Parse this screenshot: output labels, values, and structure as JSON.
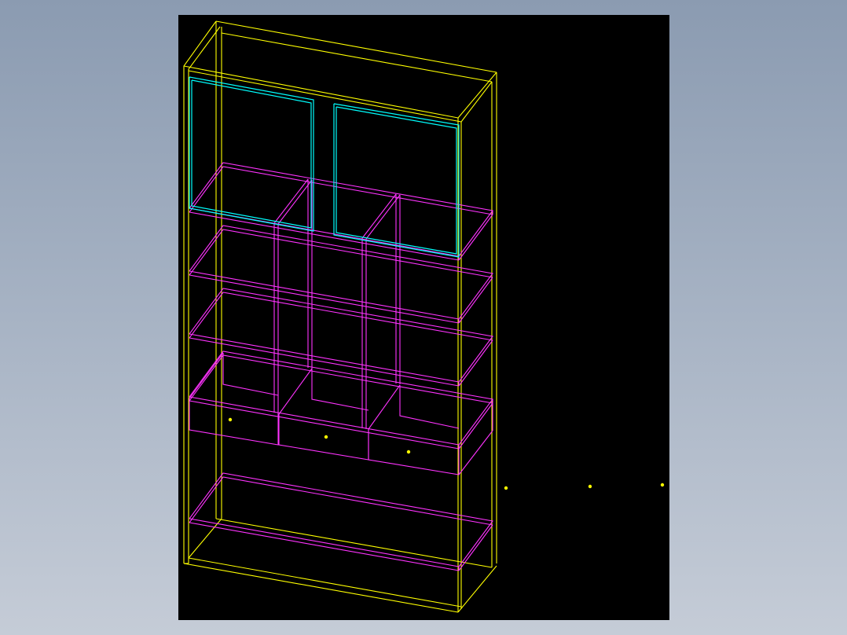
{
  "viewport": {
    "background": "#000000",
    "page_background_top": "#8b9bb1",
    "page_background_bottom": "#c5ccd7"
  },
  "drawing": {
    "subject": "bookcase-wireframe",
    "colors": {
      "carcass": "#ffff00",
      "shelves": "#ff33ff",
      "glass_doors": "#00ffff",
      "points": "#ffff00"
    },
    "layers": [
      "carcass",
      "shelves",
      "drawers",
      "glass-doors",
      "reference-points"
    ],
    "drawer_count": 3,
    "shelf_count": 5,
    "door_count": 2
  }
}
